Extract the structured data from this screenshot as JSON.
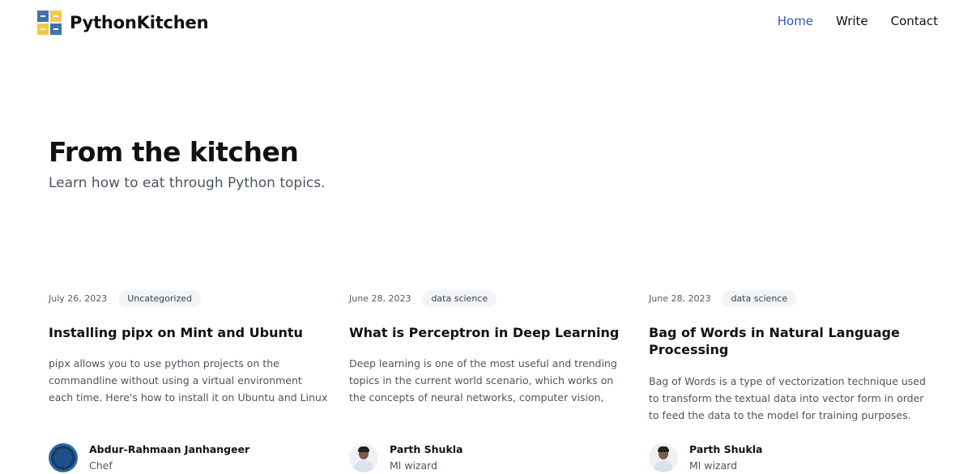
{
  "brand": {
    "name": "PythonKitchen"
  },
  "nav": {
    "items": [
      {
        "label": "Home",
        "active": true
      },
      {
        "label": "Write",
        "active": false
      },
      {
        "label": "Contact",
        "active": false
      }
    ]
  },
  "hero": {
    "title": "From the kitchen",
    "subtitle": "Learn how to eat through Python topics."
  },
  "posts": [
    {
      "date": "July 26, 2023",
      "tag": "Uncategorized",
      "title": "Installing pipx on Mint and Ubuntu",
      "excerpt": "pipx allows you to use python projects on the commandline without using a virtual environment each time. Here's how to install it on Ubuntu and Linux Mint ...",
      "author": {
        "name": "Abdur-Rahmaan Janhangeer",
        "role": "Chef"
      }
    },
    {
      "date": "June 28, 2023",
      "tag": "data science",
      "title": "What is Perceptron in Deep Learning",
      "excerpt": "Deep learning is one of the most useful and trending topics in the current world scenario, which works on the concepts of neural networks, computer vision, perceptrons, and ma…",
      "author": {
        "name": "Parth Shukla",
        "role": "Ml wizard"
      }
    },
    {
      "date": "June 28, 2023",
      "tag": "data science",
      "title": "Bag of Words in Natural Language Processing",
      "excerpt": "Bag of Words is a type of vectorization technique used to transform the textual data into vector form in order to feed the data to the model for training purposes. The bag of…",
      "author": {
        "name": "Parth Shukla",
        "role": "Ml wizard"
      }
    }
  ],
  "colors": {
    "accent": "#2f54c8",
    "logo_blue": "#3f74a8",
    "logo_yellow": "#f2c94c"
  }
}
